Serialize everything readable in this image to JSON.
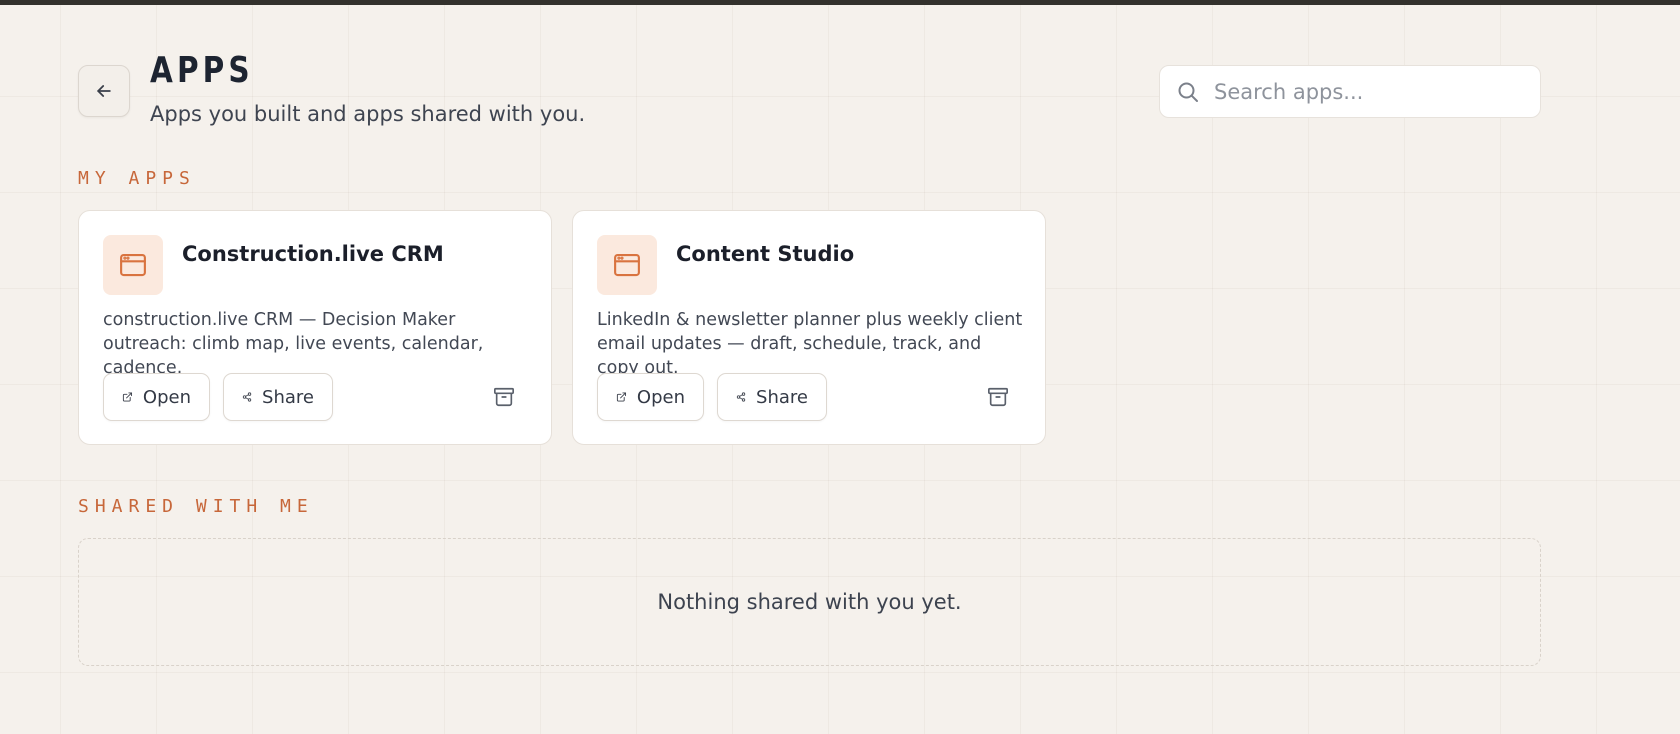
{
  "header": {
    "title": "APPS",
    "subtitle": "Apps you built and apps shared with you."
  },
  "search": {
    "placeholder": "Search apps..."
  },
  "my_apps": {
    "label": "MY APPS",
    "cards": [
      {
        "title": "Construction.live CRM",
        "description": "construction.live CRM — Decision Maker outreach: climb map, live events, calendar, cadence.",
        "open_label": "Open",
        "share_label": "Share",
        "icon": "app-window-icon"
      },
      {
        "title": "Content Studio",
        "description": "LinkedIn & newsletter planner plus weekly client email updates — draft, schedule, track, and copy out.",
        "open_label": "Open",
        "share_label": "Share",
        "icon": "app-window-icon"
      }
    ]
  },
  "shared": {
    "label": "SHARED WITH ME",
    "empty_text": "Nothing shared with you yet."
  },
  "colors": {
    "accent": "#c7673a",
    "icon_bg": "#fbe9de",
    "background": "#f5f1ec"
  }
}
